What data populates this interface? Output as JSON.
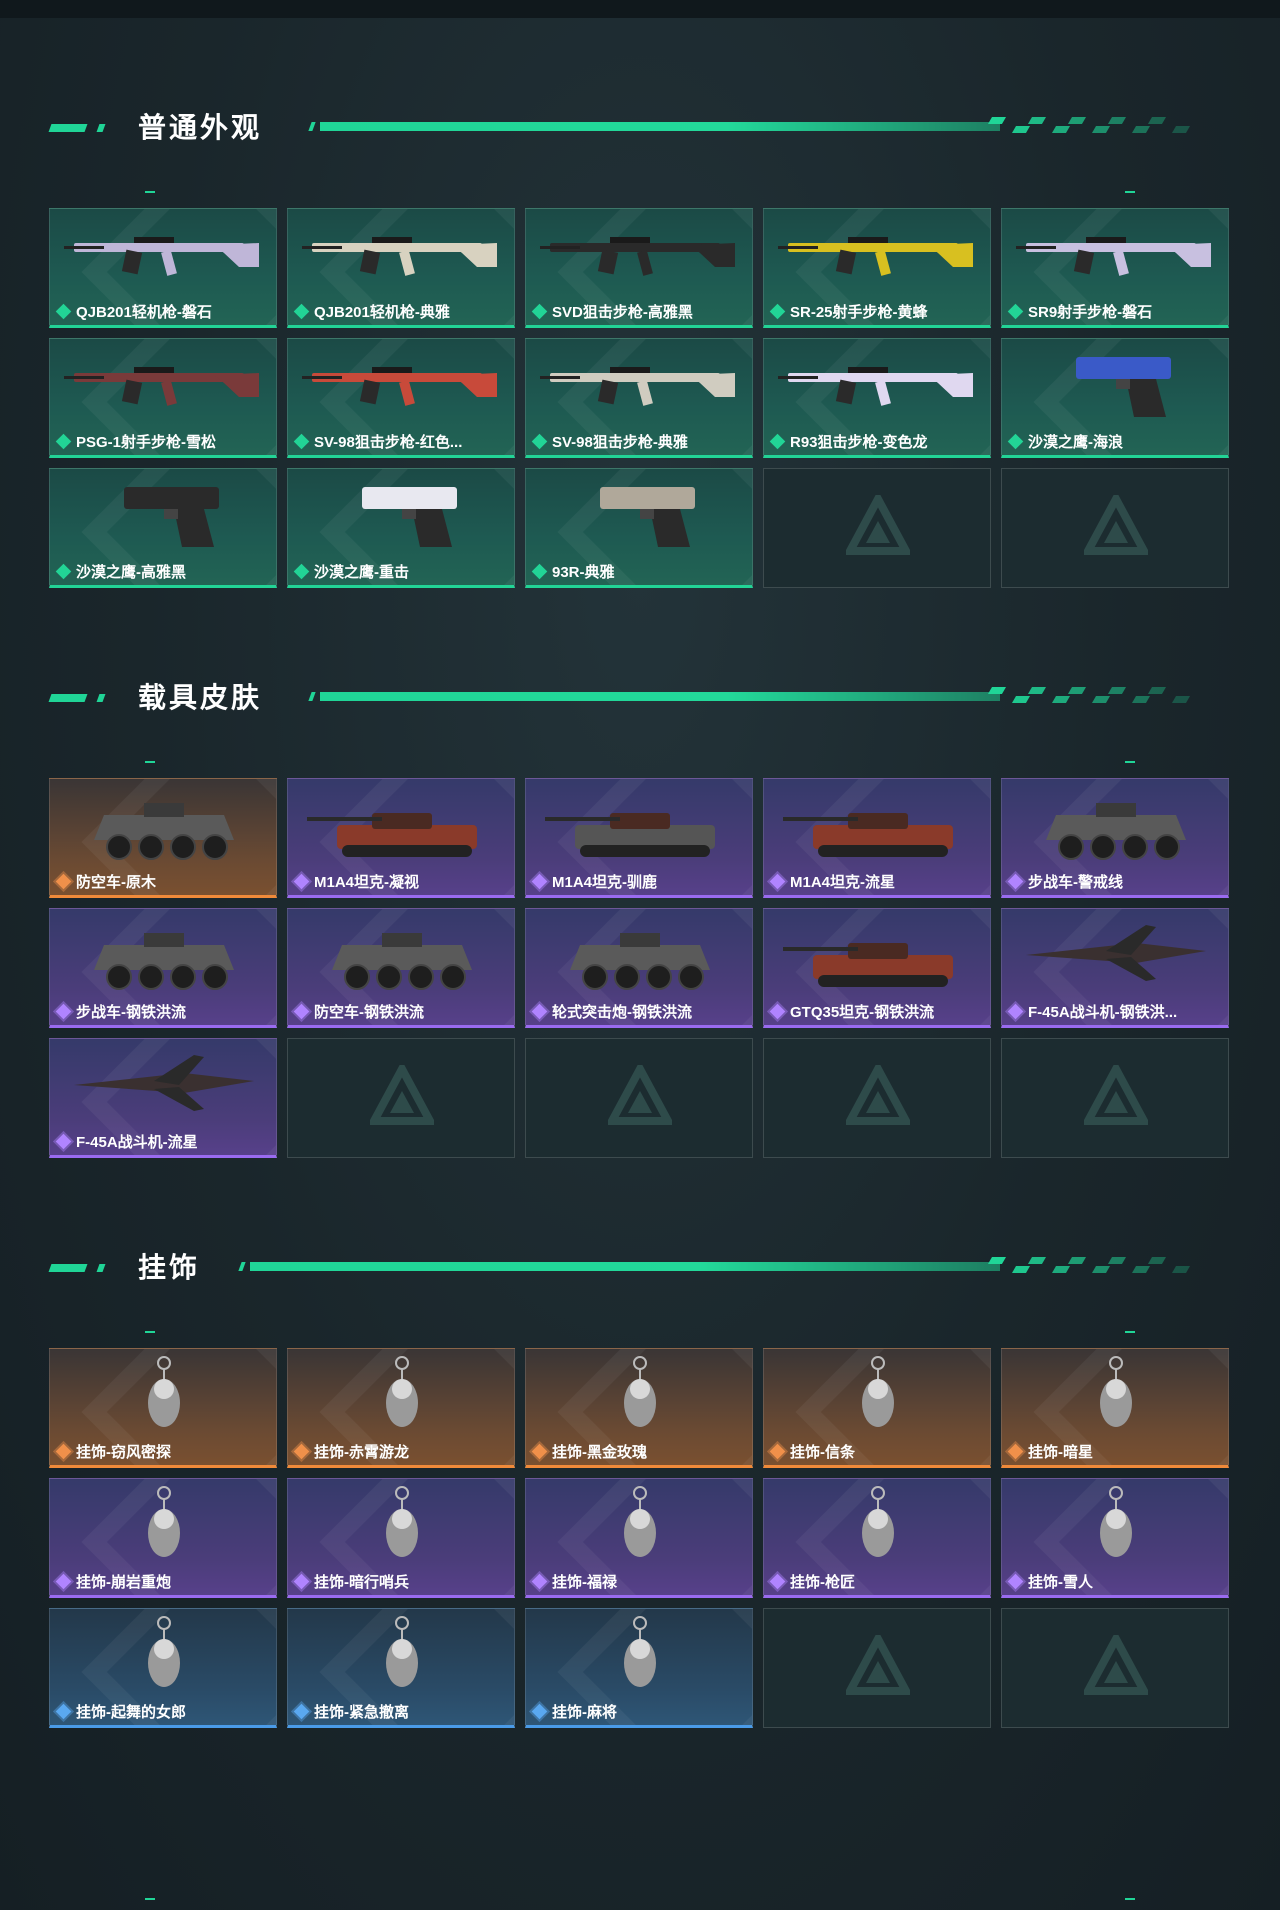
{
  "colors": {
    "accent": "#20d597",
    "purple": "#9a6bf0",
    "orange": "#f08a3a",
    "blue": "#4a9be8"
  },
  "sections": [
    {
      "title": "普通外观",
      "items": [
        {
          "label": "QJB201轻机枪-磐石",
          "rarity": "green",
          "icon": "rifle-icon"
        },
        {
          "label": "QJB201轻机枪-典雅",
          "rarity": "green",
          "icon": "rifle-icon"
        },
        {
          "label": "SVD狙击步枪-高雅黑",
          "rarity": "green",
          "icon": "rifle-icon"
        },
        {
          "label": "SR-25射手步枪-黄蜂",
          "rarity": "green",
          "icon": "rifle-icon"
        },
        {
          "label": "SR9射手步枪-磐石",
          "rarity": "green",
          "icon": "rifle-icon"
        },
        {
          "label": "PSG-1射手步枪-雪松",
          "rarity": "green",
          "icon": "rifle-icon"
        },
        {
          "label": "SV-98狙击步枪-红色...",
          "rarity": "green",
          "icon": "rifle-icon"
        },
        {
          "label": "SV-98狙击步枪-典雅",
          "rarity": "green",
          "icon": "rifle-icon"
        },
        {
          "label": "R93狙击步枪-变色龙",
          "rarity": "green",
          "icon": "rifle-icon"
        },
        {
          "label": "沙漠之鹰-海浪",
          "rarity": "green",
          "icon": "pistol-icon"
        },
        {
          "label": "沙漠之鹰-高雅黑",
          "rarity": "green",
          "icon": "pistol-icon"
        },
        {
          "label": "沙漠之鹰-重击",
          "rarity": "green",
          "icon": "pistol-icon"
        },
        {
          "label": "93R-典雅",
          "rarity": "green",
          "icon": "pistol-icon"
        },
        {
          "label": "",
          "rarity": "empty",
          "icon": "placeholder-logo-icon"
        },
        {
          "label": "",
          "rarity": "empty",
          "icon": "placeholder-logo-icon"
        }
      ]
    },
    {
      "title": "载具皮肤",
      "items": [
        {
          "label": "防空车-原木",
          "rarity": "orange",
          "icon": "vehicle-icon"
        },
        {
          "label": "M1A4坦克-凝视",
          "rarity": "purple",
          "icon": "tank-icon"
        },
        {
          "label": "M1A4坦克-驯鹿",
          "rarity": "purple",
          "icon": "tank-icon"
        },
        {
          "label": "M1A4坦克-流星",
          "rarity": "purple",
          "icon": "tank-icon"
        },
        {
          "label": "步战车-警戒线",
          "rarity": "purple",
          "icon": "vehicle-icon"
        },
        {
          "label": "步战车-钢铁洪流",
          "rarity": "purple",
          "icon": "vehicle-icon"
        },
        {
          "label": "防空车-钢铁洪流",
          "rarity": "purple",
          "icon": "vehicle-icon"
        },
        {
          "label": "轮式突击炮-钢铁洪流",
          "rarity": "purple",
          "icon": "vehicle-icon"
        },
        {
          "label": "GTQ35坦克-钢铁洪流",
          "rarity": "purple",
          "icon": "tank-icon"
        },
        {
          "label": "F-45A战斗机-钢铁洪...",
          "rarity": "purple",
          "icon": "jet-icon"
        },
        {
          "label": "F-45A战斗机-流星",
          "rarity": "purple",
          "icon": "jet-icon"
        },
        {
          "label": "",
          "rarity": "empty",
          "icon": "placeholder-logo-icon"
        },
        {
          "label": "",
          "rarity": "empty",
          "icon": "placeholder-logo-icon"
        },
        {
          "label": "",
          "rarity": "empty",
          "icon": "placeholder-logo-icon"
        },
        {
          "label": "",
          "rarity": "empty",
          "icon": "placeholder-logo-icon"
        }
      ]
    },
    {
      "title": "挂饰",
      "items": [
        {
          "label": "挂饰-窃风密探",
          "rarity": "orange",
          "icon": "charm-icon"
        },
        {
          "label": "挂饰-赤霄游龙",
          "rarity": "orange",
          "icon": "charm-icon"
        },
        {
          "label": "挂饰-黑金玫瑰",
          "rarity": "orange",
          "icon": "charm-icon"
        },
        {
          "label": "挂饰-信条",
          "rarity": "orange",
          "icon": "charm-icon"
        },
        {
          "label": "挂饰-暗星",
          "rarity": "orange",
          "icon": "charm-icon"
        },
        {
          "label": "挂饰-崩岩重炮",
          "rarity": "purple",
          "icon": "charm-icon"
        },
        {
          "label": "挂饰-暗行哨兵",
          "rarity": "purple",
          "icon": "charm-icon"
        },
        {
          "label": "挂饰-福禄",
          "rarity": "purple",
          "icon": "charm-icon"
        },
        {
          "label": "挂饰-枪匠",
          "rarity": "purple",
          "icon": "charm-icon"
        },
        {
          "label": "挂饰-雪人",
          "rarity": "purple",
          "icon": "charm-icon"
        },
        {
          "label": "挂饰-起舞的女郎",
          "rarity": "blue",
          "icon": "charm-icon"
        },
        {
          "label": "挂饰-紧急撤离",
          "rarity": "blue",
          "icon": "charm-icon"
        },
        {
          "label": "挂饰-麻将",
          "rarity": "blue",
          "icon": "charm-icon"
        },
        {
          "label": "",
          "rarity": "empty",
          "icon": "placeholder-logo-icon"
        },
        {
          "label": "",
          "rarity": "empty",
          "icon": "placeholder-logo-icon"
        }
      ]
    }
  ]
}
